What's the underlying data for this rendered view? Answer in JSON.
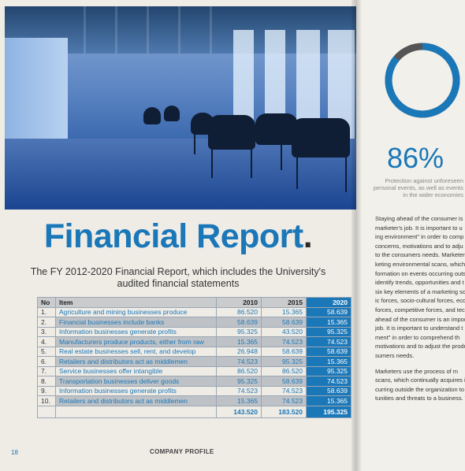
{
  "report": {
    "title": "Financial Report",
    "title_dot": ".",
    "subtitle": "The FY 2012-2020 Financial Report, which includes the University's audited financial statements"
  },
  "table": {
    "headers": [
      "No",
      "Item",
      "2010",
      "2015",
      "2020"
    ],
    "rows": [
      {
        "no": "1.",
        "item": "Agriculture and mining businesses produce",
        "v2010": "86.520",
        "v2015": "15.365",
        "v2020": "58.639"
      },
      {
        "no": "2.",
        "item": "Financial businesses include banks",
        "v2010": "58.639",
        "v2015": "58.639",
        "v2020": "15.365"
      },
      {
        "no": "3.",
        "item": "Information businesses generate profits",
        "v2010": "95.325",
        "v2015": "43.520",
        "v2020": "95.325"
      },
      {
        "no": "4.",
        "item": "Manufacturers produce products, either from raw",
        "v2010": "15.365",
        "v2015": "74.523",
        "v2020": "74.523"
      },
      {
        "no": "5.",
        "item": "Real estate businesses sell, rent, and develop",
        "v2010": "26.948",
        "v2015": "58.639",
        "v2020": "58.639"
      },
      {
        "no": "6.",
        "item": "Retailers and distributors act as middlemen",
        "v2010": "74.523",
        "v2015": "95.325",
        "v2020": "15.365"
      },
      {
        "no": "7.",
        "item": "Service businesses offer intangible",
        "v2010": "86.520",
        "v2015": "86.520",
        "v2020": "95.325"
      },
      {
        "no": "8.",
        "item": "Transportation businesses deliver goods",
        "v2010": "95.325",
        "v2015": "58.639",
        "v2020": "74.523"
      },
      {
        "no": "9.",
        "item": "Information businesses generate profits",
        "v2010": "74.523",
        "v2015": "74.523",
        "v2020": "58.639"
      },
      {
        "no": "10.",
        "item": "Retailers and distributors act as middlemen",
        "v2010": "15.365",
        "v2015": "74.523",
        "v2020": "15.365"
      }
    ],
    "totals": {
      "v2010": "143.520",
      "v2015": "183.520",
      "v2020": "195.325"
    }
  },
  "footer": {
    "page_number": "18",
    "label": "COMPANY PROFILE"
  },
  "right_page": {
    "donut_percent": 86,
    "percent_label": "86%",
    "caption_lines": [
      "Protection against unforeseen",
      "personal events, as well as events",
      "in the wider economies"
    ],
    "body_lines_1": [
      "Staying ahead of the consumer is",
      "marketer's job. It is important to u",
      "ing environment\" in order to comp",
      "concerns, motivations and to adju",
      "to the consumers needs. Marketers",
      "keting environmental scans, which",
      "formation on events occurring outs",
      "identify trends, opportunities and t",
      "six key elements of a marketing sc",
      "ic forces, socio-cultural forces, eco",
      "forces, competitive forces, and tech",
      "ahead of the consumer is an impor",
      "job. It is important to understand t",
      "ment\" in order to comprehend th",
      "motivations and to adjust the produ",
      "sumers needs."
    ],
    "body_lines_2": [
      "Marketers use the process of m",
      "scans, which continually acquires in",
      "curring outside the organization to",
      "tunities and threats to a business. T"
    ]
  },
  "colors": {
    "accent": "#1a77b8",
    "paper": "#efece6",
    "row_shade": "#bec2c6"
  }
}
